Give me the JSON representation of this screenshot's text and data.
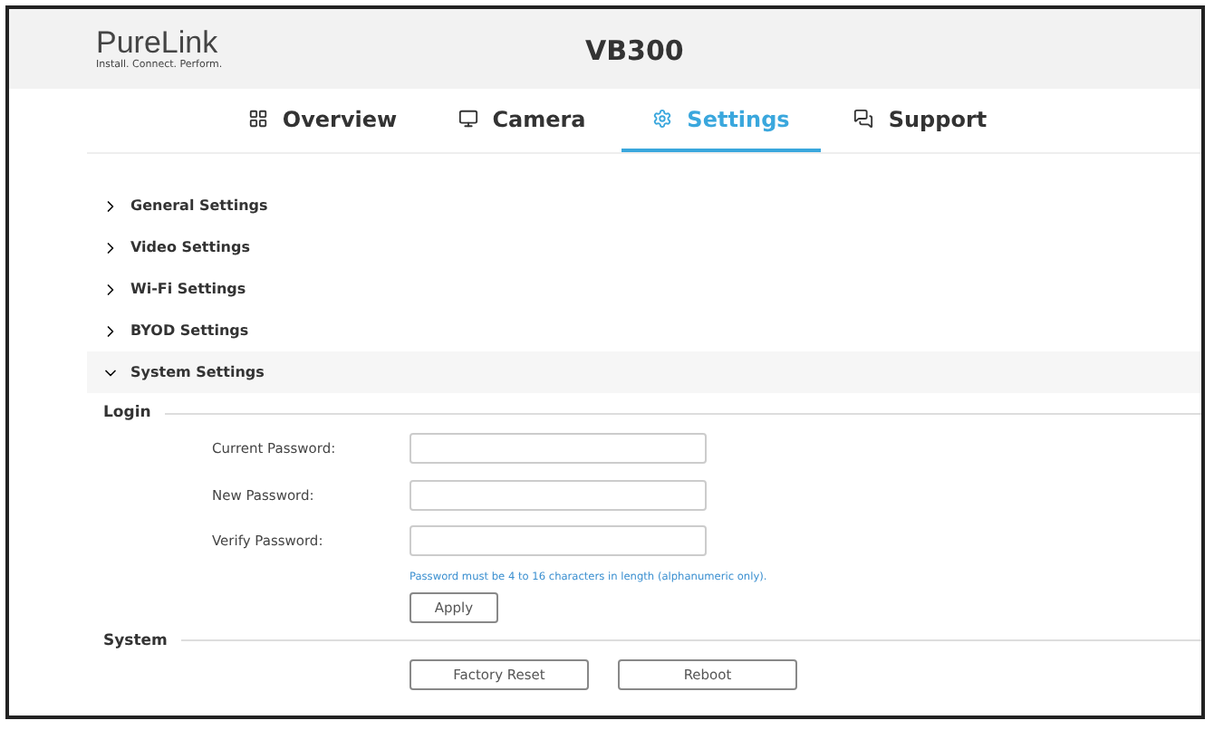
{
  "header": {
    "logo": "PureLink",
    "tagline": "Install. Connect. Perform.",
    "title": "VB300"
  },
  "tabs": [
    {
      "label": "Overview",
      "kind": "grid",
      "selected": false
    },
    {
      "label": "Camera",
      "kind": "camera",
      "selected": false
    },
    {
      "label": "Settings",
      "kind": "gear",
      "selected": true
    },
    {
      "label": "Support",
      "kind": "chat",
      "selected": false
    }
  ],
  "sections": [
    {
      "label": "General Settings",
      "expanded": false
    },
    {
      "label": "Video Settings",
      "expanded": false
    },
    {
      "label": "Wi-Fi Settings",
      "expanded": false
    },
    {
      "label": "BYOD Settings",
      "expanded": false
    },
    {
      "label": "System Settings",
      "expanded": true
    }
  ],
  "login": {
    "heading": "Login",
    "fields": [
      {
        "label": "Current Password:"
      },
      {
        "label": "New Password:"
      },
      {
        "label": "Verify Password:"
      }
    ],
    "hint": "Password must be 4 to 16 characters in length (alphanumeric only).",
    "apply": "Apply"
  },
  "system": {
    "heading": "System",
    "buttons": [
      "Factory Reset",
      "Reboot"
    ]
  }
}
